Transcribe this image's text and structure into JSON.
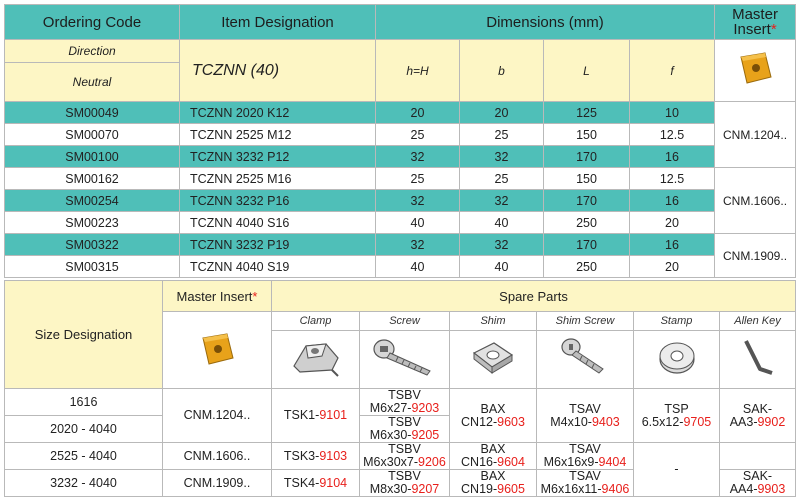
{
  "table1": {
    "headers": {
      "ordering_code": "Ordering Code",
      "item_designation": "Item Designation",
      "dimensions": "Dimensions (mm)",
      "master_insert": "Master Insert",
      "star": "*"
    },
    "sub": {
      "direction": "Direction",
      "neutral": "Neutral",
      "tcznn": "TCZNN (40)",
      "h": "h=H",
      "b": "b",
      "L": "L",
      "f": "f"
    },
    "rows": [
      {
        "code": "SM00049",
        "item": "TCZNN 2020 K12",
        "h": "20",
        "b": "20",
        "L": "125",
        "f": "10"
      },
      {
        "code": "SM00070",
        "item": "TCZNN 2525 M12",
        "h": "25",
        "b": "25",
        "L": "150",
        "f": "12.5"
      },
      {
        "code": "SM00100",
        "item": "TCZNN 3232 P12",
        "h": "32",
        "b": "32",
        "L": "170",
        "f": "16"
      },
      {
        "code": "SM00162",
        "item": "TCZNN 2525 M16",
        "h": "25",
        "b": "25",
        "L": "150",
        "f": "12.5"
      },
      {
        "code": "SM00254",
        "item": "TCZNN 3232 P16",
        "h": "32",
        "b": "32",
        "L": "170",
        "f": "16"
      },
      {
        "code": "SM00223",
        "item": "TCZNN 4040 S16",
        "h": "40",
        "b": "40",
        "L": "250",
        "f": "20"
      },
      {
        "code": "SM00322",
        "item": "TCZNN 3232 P19",
        "h": "32",
        "b": "32",
        "L": "170",
        "f": "16"
      },
      {
        "code": "SM00315",
        "item": "TCZNN 4040 S19",
        "h": "40",
        "b": "40",
        "L": "250",
        "f": "20"
      }
    ],
    "inserts": [
      "CNM.1204..",
      "CNM.1606..",
      "CNM.1909.."
    ]
  },
  "table2": {
    "headers": {
      "size_designation": "Size Designation",
      "master_insert": "Master Insert",
      "star": "*",
      "spare_parts": "Spare Parts"
    },
    "parts": [
      "Clamp",
      "Screw",
      "Shim",
      "Shim Screw",
      "Stamp",
      "Allen Key"
    ],
    "sizes": [
      "1616",
      "2020 - 4040",
      "2525 - 4040",
      "3232 - 4040"
    ],
    "inserts": [
      "CNM.1204..",
      "CNM.1606..",
      "CNM.1909.."
    ],
    "clamp": [
      {
        "base": "TSK1-",
        "code": "9101"
      },
      {
        "base": "TSK3-",
        "code": "9103"
      },
      {
        "base": "TSK4-",
        "code": "9104"
      }
    ],
    "screw": [
      {
        "l1": "TSBV",
        "l2": "M6x27-",
        "code": "9203"
      },
      {
        "l1": "TSBV",
        "l2": "M6x30-",
        "code": "9205"
      },
      {
        "l1": "TSBV",
        "l2": "M6x30x7-",
        "code": "9206"
      },
      {
        "l1": "TSBV",
        "l2": "M8x30-",
        "code": "9207"
      }
    ],
    "shim": [
      {
        "l1": "BAX",
        "l2": "CN12-",
        "code": "9603"
      },
      {
        "l1": "BAX",
        "l2": "CN16-",
        "code": "9604"
      },
      {
        "l1": "BAX",
        "l2": "CN19-",
        "code": "9605"
      }
    ],
    "shim_screw": [
      {
        "l1": "TSAV",
        "l2": "M4x10-",
        "code": "9403"
      },
      {
        "l1": "TSAV",
        "l2": "M6x16x9-",
        "code": "9404"
      },
      {
        "l1": "TSAV",
        "l2": "M6x16x11-",
        "code": "9406"
      }
    ],
    "stamp": [
      {
        "l1": "TSP",
        "l2": "6.5x12-",
        "code": "9705"
      },
      {
        "l1": "-",
        "l2": "",
        "code": ""
      }
    ],
    "allen_key": [
      {
        "l1": "SAK-",
        "l2": "AA3-",
        "code": "9902"
      },
      {
        "l1": "SAK-",
        "l2": "AA4-",
        "code": "9903"
      }
    ]
  },
  "colors": {
    "teal": "#4fbfb8",
    "cream": "#fdf6c5",
    "red": "#e8201c",
    "insert_gold": "#e8a21a"
  }
}
